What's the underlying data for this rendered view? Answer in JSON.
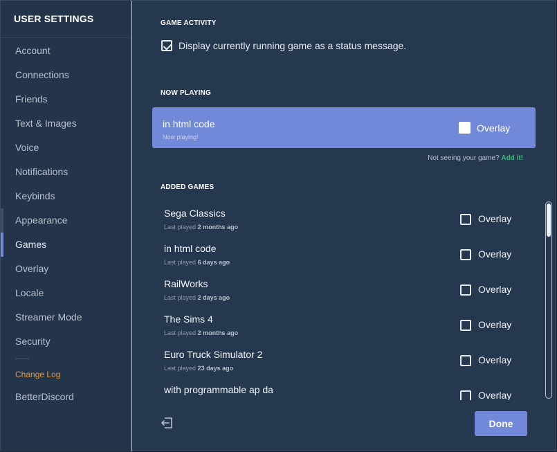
{
  "sidebar": {
    "title": "User Settings",
    "items": [
      {
        "label": "Account"
      },
      {
        "label": "Connections"
      },
      {
        "label": "Friends"
      },
      {
        "label": "Text & Images"
      },
      {
        "label": "Voice"
      },
      {
        "label": "Notifications"
      },
      {
        "label": "Keybinds"
      },
      {
        "label": "Appearance"
      },
      {
        "label": "Games"
      },
      {
        "label": "Overlay"
      },
      {
        "label": "Locale"
      },
      {
        "label": "Streamer Mode"
      },
      {
        "label": "Security"
      }
    ],
    "active_item": "Games",
    "changelog_label": "Change Log",
    "betterdiscord_label": "BetterDiscord"
  },
  "game_activity": {
    "heading": "Game Activity",
    "checkbox_label": "Display currently running game as a status message.",
    "checked": true
  },
  "now_playing": {
    "heading": "Now Playing",
    "game_name": "in html code",
    "status": "Now playing!",
    "overlay_label": "Overlay",
    "not_seeing_text": "Not seeing your game?",
    "add_it_label": "Add it!"
  },
  "added_games": {
    "heading": "Added Games",
    "last_played_prefix": "Last played",
    "overlay_label": "Overlay",
    "games": [
      {
        "name": "Sega Classics",
        "last_played": "2 months ago"
      },
      {
        "name": "in html code",
        "last_played": "6 days ago"
      },
      {
        "name": "RailWorks",
        "last_played": "2 days ago"
      },
      {
        "name": "The Sims 4",
        "last_played": "2 months ago"
      },
      {
        "name": "Euro Truck Simulator 2",
        "last_played": "23 days ago"
      },
      {
        "name": "with programmable ap da",
        "last_played": ""
      }
    ]
  },
  "footer": {
    "done_label": "Done",
    "exit_icon": "exit-icon"
  },
  "colors": {
    "accent": "#7289da",
    "link_green": "#43b581",
    "changelog_orange": "#e39b3a",
    "background": "#263850",
    "sidebar": "#24344a"
  }
}
